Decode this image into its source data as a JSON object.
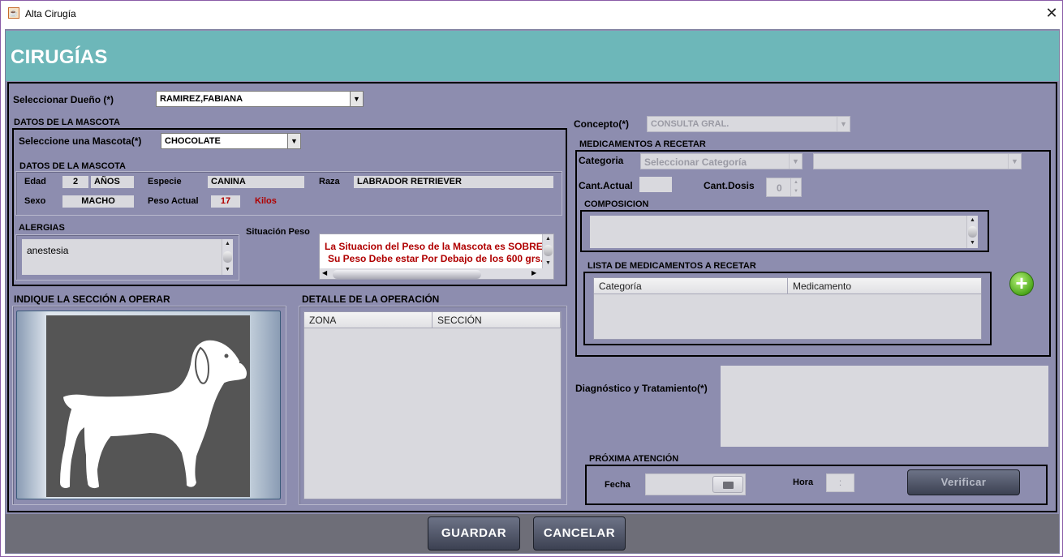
{
  "window": {
    "title": "Alta Cirugía",
    "close_symbol": "✕"
  },
  "header": {
    "title": "CIRUGÍAS"
  },
  "owner": {
    "label": "Seleccionar Dueño  (*)",
    "value": "RAMIREZ,FABIANA"
  },
  "pet_section": {
    "title": "DATOS DE LA MASCOTA",
    "select_label": "Seleccione una Mascota(*)",
    "select_value": "CHOCOLATE",
    "details_title": "DATOS DE LA MASCOTA",
    "age_label": "Edad",
    "age_value": "2",
    "age_unit": "AÑOS",
    "species_label": "Especie",
    "species_value": "CANINA",
    "breed_label": "Raza",
    "breed_value": "LABRADOR RETRIEVER",
    "sex_label": "Sexo",
    "sex_value": "MACHO",
    "weight_label": "Peso Actual",
    "weight_value": "17",
    "weight_unit": "Kilos",
    "allergies_label": "ALERGIAS",
    "allergies_value": "anestesia",
    "weight_status_label": "Situación Peso",
    "weight_status_line1": "La Situacion del Peso de la Mascota es SOBREPESO",
    "weight_status_line2": "Su Peso Debe estar Por Debajo de los 600 grs."
  },
  "section_select": {
    "title": "INDIQUE LA SECCIÓN A OPERAR"
  },
  "operation_detail": {
    "title": "DETALLE DE LA OPERACIÓN",
    "columns": [
      "ZONA",
      "SECCIÓN"
    ]
  },
  "concept": {
    "label": "Concepto(*)",
    "value": "CONSULTA GRAL."
  },
  "medications": {
    "title": "MEDICAMENTOS A RECETAR",
    "category_label": "Categoria",
    "category_value": "Seleccionar Categoría",
    "cant_actual_label": "Cant.Actual",
    "cant_dosis_label": "Cant.Dosis",
    "cant_dosis_value": "0",
    "composition_label": "COMPOSICION",
    "list_title": "LISTA DE MEDICAMENTOS A RECETAR",
    "columns": [
      "Categoría",
      "Medicamento"
    ],
    "add_icon": "plus-icon"
  },
  "diagnosis": {
    "label": "Diagnóstico y Tratamiento(*)"
  },
  "next_visit": {
    "title": "PRÓXIMA ATENCIÓN",
    "date_label": "Fecha",
    "time_label": "Hora",
    "time_value": ":",
    "verify_label": "Verificar"
  },
  "footer": {
    "save_label": "GUARDAR",
    "cancel_label": "CANCELAR"
  },
  "colors": {
    "header": "#6db7b9",
    "panel": "#8d8daf",
    "warning_text": "#b00000",
    "footer": "#6e6e78"
  }
}
